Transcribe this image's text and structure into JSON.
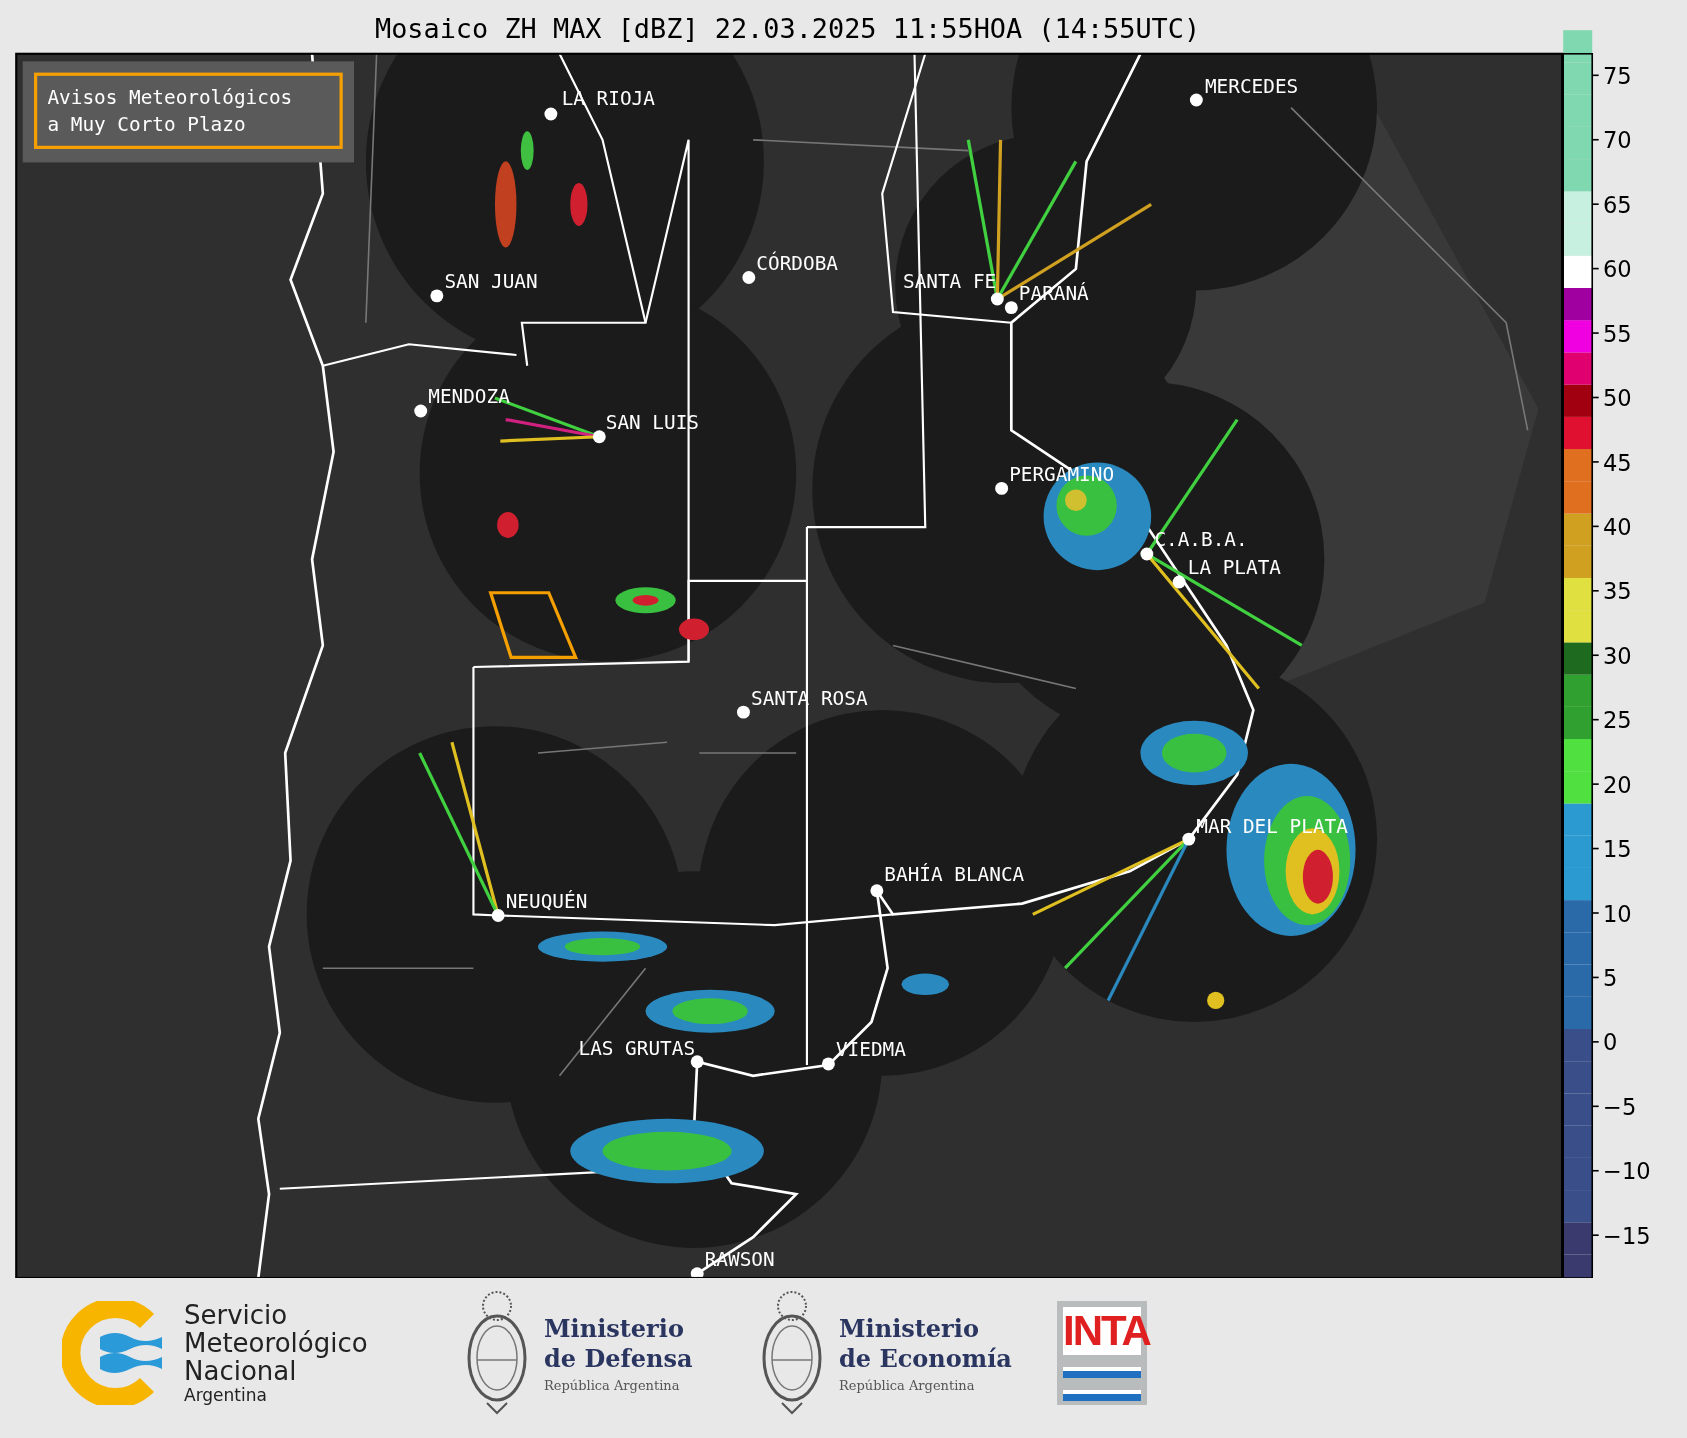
{
  "title": "Mosaico ZH MAX [dBZ] 22.03.2025 11:55HOA (14:55UTC)",
  "legend_box": {
    "lines": [
      "Avisos Meteorológicos",
      "a Muy Corto Plazo"
    ]
  },
  "cities": [
    {
      "name": "MERCEDES"
    },
    {
      "name": "LA RIOJA"
    },
    {
      "name": "CÓRDOBA"
    },
    {
      "name": "SAN JUAN"
    },
    {
      "name": "SANTA FE"
    },
    {
      "name": "PARANÁ"
    },
    {
      "name": "MENDOZA"
    },
    {
      "name": "SAN LUIS"
    },
    {
      "name": "PERGAMINO"
    },
    {
      "name": "C.A.B.A."
    },
    {
      "name": "LA PLATA"
    },
    {
      "name": "SANTA ROSA"
    },
    {
      "name": "MAR DEL PLATA"
    },
    {
      "name": "BAHÍA BLANCA"
    },
    {
      "name": "NEUQUÉN"
    },
    {
      "name": "LAS GRUTAS"
    },
    {
      "name": "VIEDMA"
    },
    {
      "name": "RAWSON"
    }
  ],
  "colorbar": {
    "ticks": [
      "75",
      "70",
      "65",
      "60",
      "55",
      "50",
      "45",
      "40",
      "35",
      "30",
      "25",
      "20",
      "15",
      "10",
      "5",
      "0",
      "−5",
      "−10",
      "−15"
    ]
  },
  "footer": {
    "logos": [
      {
        "kind": "smn",
        "lines": [
          "Servicio",
          "Meteorológico",
          "Nacional"
        ],
        "subtitle": "Argentina"
      },
      {
        "kind": "ministry",
        "lines": [
          "Ministerio",
          "de Defensa"
        ],
        "subtitle": "República Argentina"
      },
      {
        "kind": "ministry",
        "lines": [
          "Ministerio",
          "de Economía"
        ],
        "subtitle": "República Argentina"
      },
      {
        "kind": "inta",
        "lines": [
          "INTA"
        ]
      }
    ]
  }
}
